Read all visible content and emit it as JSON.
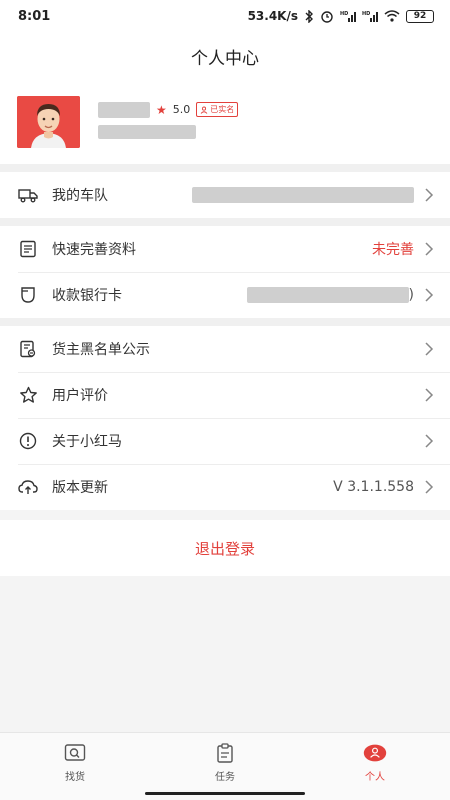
{
  "status": {
    "time": "8:01",
    "speed": "53.4K/s",
    "battery": "92",
    "icons": [
      "bluetooth-icon",
      "alarm-icon",
      "signal-hd-icon",
      "signal-hd-icon",
      "wifi-icon",
      "battery-icon"
    ]
  },
  "header": {
    "title": "个人中心"
  },
  "profile": {
    "rating": "5.0",
    "verified_label": "已实名"
  },
  "menu": {
    "fleet": {
      "label": "我的车队",
      "icon": "truck-icon"
    },
    "complete_profile": {
      "label": "快速完善资料",
      "value": "未完善",
      "icon": "document-icon"
    },
    "bank_card": {
      "label": "收款银行卡",
      "value_suffix": ")",
      "icon": "cup-shield-icon"
    },
    "blacklist": {
      "label": "货主黑名单公示",
      "icon": "list-check-icon"
    },
    "reviews": {
      "label": "用户评价",
      "icon": "star-outline-icon"
    },
    "about": {
      "label": "关于小红马",
      "icon": "info-circle-icon"
    },
    "version": {
      "label": "版本更新",
      "value": "V 3.1.1.558",
      "icon": "cloud-upload-icon"
    }
  },
  "logout": {
    "label": "退出登录"
  },
  "tabs": [
    {
      "label": "找货",
      "icon": "search-box-icon",
      "active": false
    },
    {
      "label": "任务",
      "icon": "clipboard-icon",
      "active": false
    },
    {
      "label": "个人",
      "icon": "person-icon",
      "active": true
    }
  ],
  "colors": {
    "accent": "#e2413c",
    "avatar_bg": "#e94a44"
  }
}
